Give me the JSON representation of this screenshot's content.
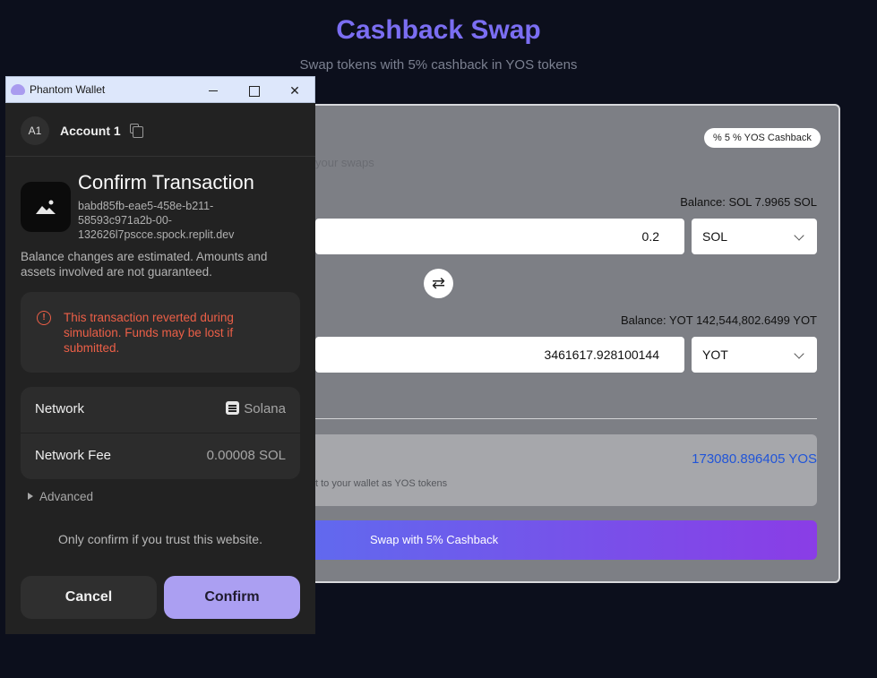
{
  "page": {
    "title": "Cashback Swap",
    "subtitle": "Swap tokens with 5% cashback in YOS tokens"
  },
  "card": {
    "badge": "% 5 % YOS Cashback",
    "faint_text": "your swaps",
    "from": {
      "balance": "Balance: SOL 7.9965 SOL",
      "amount": "0.2",
      "token": "SOL"
    },
    "to": {
      "balance": "Balance: YOT 142,544,802.6499 YOT",
      "amount": "3461617.928100144",
      "token": "YOT"
    },
    "cashback_value": "173080.896405 YOS",
    "cashback_note": "t to your wallet as YOS tokens",
    "swap_button": "Swap with 5% Cashback"
  },
  "wallet": {
    "window_title": "Phantom Wallet",
    "avatar": "A1",
    "account_name": "Account 1",
    "confirm_title": "Confirm Transaction",
    "origin": "babd85fb-eae5-458e-b211-58593c971a2b-00-132626l7pscce.spock.replit.dev",
    "disclaimer": "Balance changes are estimated. Amounts and assets involved are not guaranteed.",
    "warning": "This transaction reverted during simulation. Funds may be lost if submitted.",
    "network_label": "Network",
    "network_value": "Solana",
    "fee_label": "Network Fee",
    "fee_value": "0.00008 SOL",
    "advanced": "Advanced",
    "trust_note": "Only confirm if you trust this website.",
    "cancel": "Cancel",
    "confirm": "Confirm"
  },
  "colors": {
    "title": "#7b6ef2",
    "cashback": "#2155d8",
    "warning": "#ec5f47",
    "confirm_button": "#ab9ff2"
  }
}
